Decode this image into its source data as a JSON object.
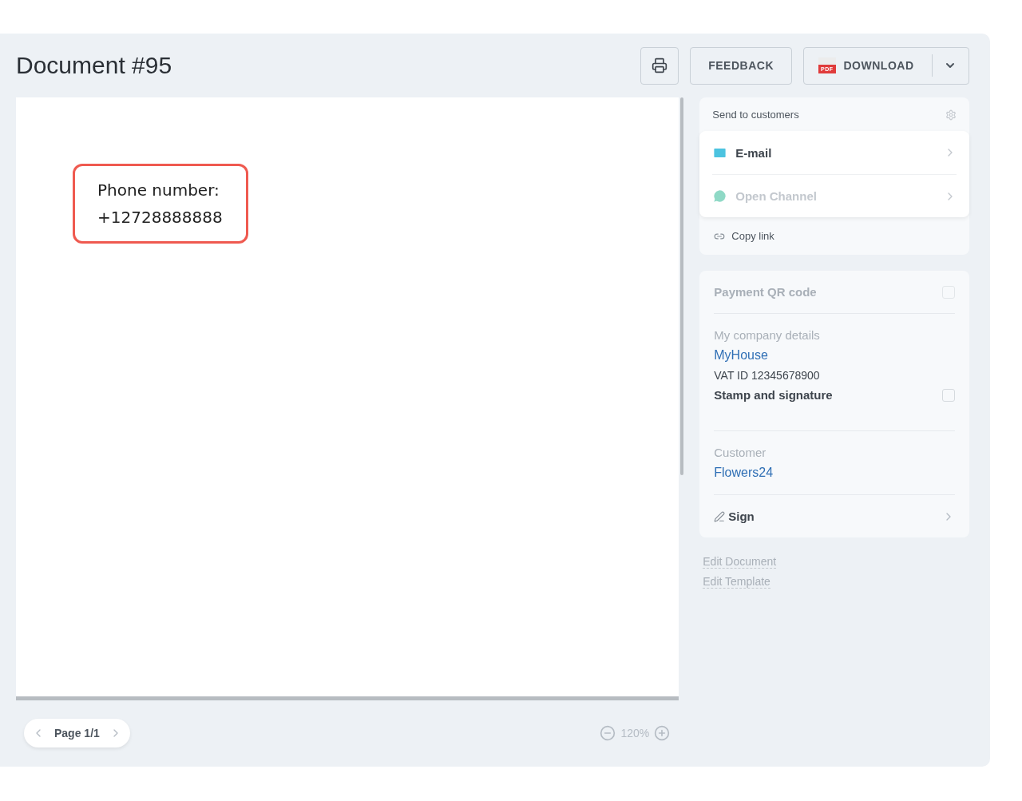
{
  "title": "Document #95",
  "toolbar": {
    "feedback": "FEEDBACK",
    "download": "DOWNLOAD",
    "pdf_badge": "PDF"
  },
  "document": {
    "note_lines": [
      "Phone number:",
      "+12728888888"
    ]
  },
  "send_panel": {
    "title": "Send to customers",
    "channels": [
      {
        "label": "E-mail",
        "kind": "email",
        "disabled": false
      },
      {
        "label": "Open Channel",
        "kind": "chat",
        "disabled": true
      }
    ],
    "copy_link": "Copy link"
  },
  "details": {
    "payment_qr": {
      "label": "Payment QR code",
      "checked": false,
      "disabled": true
    },
    "company_heading": "My company details",
    "company_name": "MyHouse",
    "vat": "VAT ID 12345678900",
    "stamp": {
      "label": "Stamp and signature",
      "checked": false,
      "disabled": false
    },
    "customer_heading": "Customer",
    "customer_name": "Flowers24",
    "sign": "Sign"
  },
  "links": [
    "Edit Document",
    "Edit Template"
  ],
  "pager": {
    "label": "Page 1/1"
  },
  "zoom": {
    "label": "120%"
  }
}
